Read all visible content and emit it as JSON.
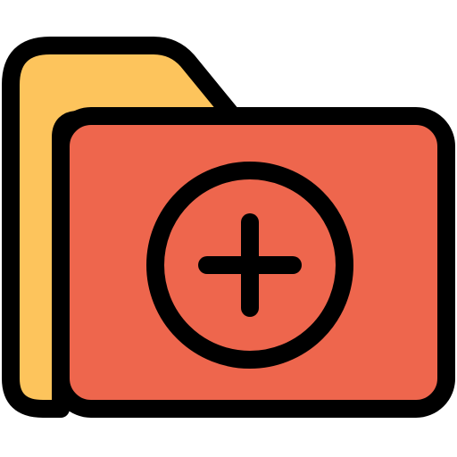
{
  "icon": {
    "name": "add-folder-icon",
    "colors": {
      "outline": "#000000",
      "back_flap": "#FDC45C",
      "front_panel": "#EE664D",
      "background": "#FFFFFF"
    }
  }
}
